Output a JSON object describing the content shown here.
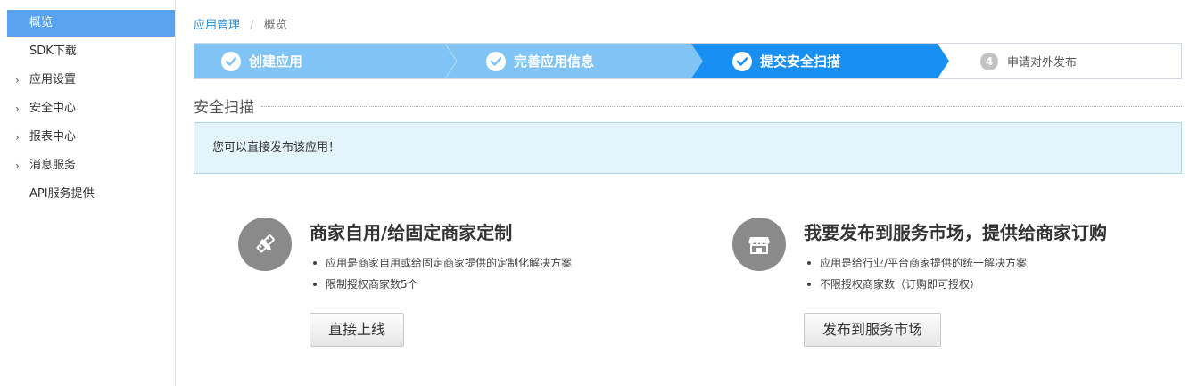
{
  "sidebar": {
    "items": [
      {
        "label": "概览",
        "active": true,
        "expandable": false
      },
      {
        "label": "SDK下载",
        "active": false,
        "expandable": false
      },
      {
        "label": "应用设置",
        "active": false,
        "expandable": true
      },
      {
        "label": "安全中心",
        "active": false,
        "expandable": true
      },
      {
        "label": "报表中心",
        "active": false,
        "expandable": true
      },
      {
        "label": "消息服务",
        "active": false,
        "expandable": true
      },
      {
        "label": "API服务提供",
        "active": false,
        "expandable": false
      }
    ],
    "arrow_glyph": "›"
  },
  "breadcrumb": {
    "parent": "应用管理",
    "separator": "/",
    "current": "概览"
  },
  "steps": [
    {
      "label": "创建应用",
      "state": "done"
    },
    {
      "label": "完善应用信息",
      "state": "done"
    },
    {
      "label": "提交安全扫描",
      "state": "active"
    },
    {
      "label": "申请对外发布",
      "state": "pending",
      "number": "4"
    }
  ],
  "section": {
    "title": "安全扫描",
    "message": "您可以直接发布该应用！"
  },
  "options": {
    "left": {
      "icon": "pencil-ruler-icon",
      "title": "商家自用/给固定商家定制",
      "bullets": [
        "应用是商家自用或给固定商家提供的定制化解决方案",
        "限制授权商家数5个"
      ],
      "button": "直接上线"
    },
    "right": {
      "icon": "storefront-icon",
      "title": "我要发布到服务市场，提供给商家订购",
      "bullets": [
        "应用是给行业/平台商家提供的统一解决方案",
        "不限授权商家数（订购即可授权）"
      ],
      "button": "发布到服务市场"
    }
  },
  "colors": {
    "accent": "#1890f3",
    "step_done": "#7fc4f5",
    "sidebar_active": "#5aa3f0",
    "info_bg": "#e4f4fb",
    "icon_circle": "#8a8a8a"
  }
}
